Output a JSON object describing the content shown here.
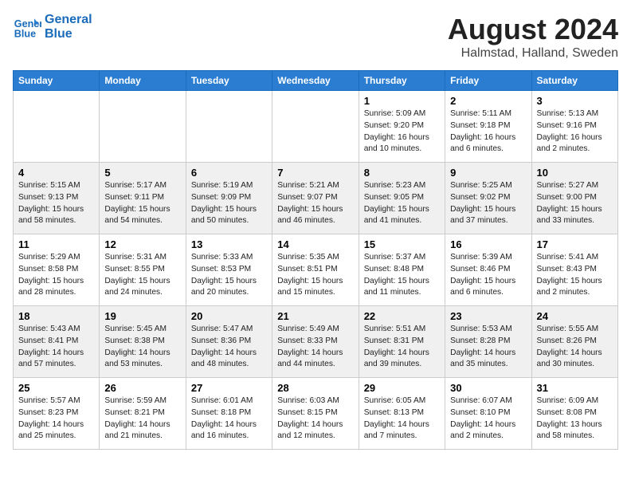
{
  "header": {
    "logo_line1": "General",
    "logo_line2": "Blue",
    "title": "August 2024",
    "subtitle": "Halmstad, Halland, Sweden"
  },
  "days_of_week": [
    "Sunday",
    "Monday",
    "Tuesday",
    "Wednesday",
    "Thursday",
    "Friday",
    "Saturday"
  ],
  "weeks": [
    [
      {
        "day": "",
        "info": ""
      },
      {
        "day": "",
        "info": ""
      },
      {
        "day": "",
        "info": ""
      },
      {
        "day": "",
        "info": ""
      },
      {
        "day": "1",
        "info": "Sunrise: 5:09 AM\nSunset: 9:20 PM\nDaylight: 16 hours\nand 10 minutes."
      },
      {
        "day": "2",
        "info": "Sunrise: 5:11 AM\nSunset: 9:18 PM\nDaylight: 16 hours\nand 6 minutes."
      },
      {
        "day": "3",
        "info": "Sunrise: 5:13 AM\nSunset: 9:16 PM\nDaylight: 16 hours\nand 2 minutes."
      }
    ],
    [
      {
        "day": "4",
        "info": "Sunrise: 5:15 AM\nSunset: 9:13 PM\nDaylight: 15 hours\nand 58 minutes."
      },
      {
        "day": "5",
        "info": "Sunrise: 5:17 AM\nSunset: 9:11 PM\nDaylight: 15 hours\nand 54 minutes."
      },
      {
        "day": "6",
        "info": "Sunrise: 5:19 AM\nSunset: 9:09 PM\nDaylight: 15 hours\nand 50 minutes."
      },
      {
        "day": "7",
        "info": "Sunrise: 5:21 AM\nSunset: 9:07 PM\nDaylight: 15 hours\nand 46 minutes."
      },
      {
        "day": "8",
        "info": "Sunrise: 5:23 AM\nSunset: 9:05 PM\nDaylight: 15 hours\nand 41 minutes."
      },
      {
        "day": "9",
        "info": "Sunrise: 5:25 AM\nSunset: 9:02 PM\nDaylight: 15 hours\nand 37 minutes."
      },
      {
        "day": "10",
        "info": "Sunrise: 5:27 AM\nSunset: 9:00 PM\nDaylight: 15 hours\nand 33 minutes."
      }
    ],
    [
      {
        "day": "11",
        "info": "Sunrise: 5:29 AM\nSunset: 8:58 PM\nDaylight: 15 hours\nand 28 minutes."
      },
      {
        "day": "12",
        "info": "Sunrise: 5:31 AM\nSunset: 8:55 PM\nDaylight: 15 hours\nand 24 minutes."
      },
      {
        "day": "13",
        "info": "Sunrise: 5:33 AM\nSunset: 8:53 PM\nDaylight: 15 hours\nand 20 minutes."
      },
      {
        "day": "14",
        "info": "Sunrise: 5:35 AM\nSunset: 8:51 PM\nDaylight: 15 hours\nand 15 minutes."
      },
      {
        "day": "15",
        "info": "Sunrise: 5:37 AM\nSunset: 8:48 PM\nDaylight: 15 hours\nand 11 minutes."
      },
      {
        "day": "16",
        "info": "Sunrise: 5:39 AM\nSunset: 8:46 PM\nDaylight: 15 hours\nand 6 minutes."
      },
      {
        "day": "17",
        "info": "Sunrise: 5:41 AM\nSunset: 8:43 PM\nDaylight: 15 hours\nand 2 minutes."
      }
    ],
    [
      {
        "day": "18",
        "info": "Sunrise: 5:43 AM\nSunset: 8:41 PM\nDaylight: 14 hours\nand 57 minutes."
      },
      {
        "day": "19",
        "info": "Sunrise: 5:45 AM\nSunset: 8:38 PM\nDaylight: 14 hours\nand 53 minutes."
      },
      {
        "day": "20",
        "info": "Sunrise: 5:47 AM\nSunset: 8:36 PM\nDaylight: 14 hours\nand 48 minutes."
      },
      {
        "day": "21",
        "info": "Sunrise: 5:49 AM\nSunset: 8:33 PM\nDaylight: 14 hours\nand 44 minutes."
      },
      {
        "day": "22",
        "info": "Sunrise: 5:51 AM\nSunset: 8:31 PM\nDaylight: 14 hours\nand 39 minutes."
      },
      {
        "day": "23",
        "info": "Sunrise: 5:53 AM\nSunset: 8:28 PM\nDaylight: 14 hours\nand 35 minutes."
      },
      {
        "day": "24",
        "info": "Sunrise: 5:55 AM\nSunset: 8:26 PM\nDaylight: 14 hours\nand 30 minutes."
      }
    ],
    [
      {
        "day": "25",
        "info": "Sunrise: 5:57 AM\nSunset: 8:23 PM\nDaylight: 14 hours\nand 25 minutes."
      },
      {
        "day": "26",
        "info": "Sunrise: 5:59 AM\nSunset: 8:21 PM\nDaylight: 14 hours\nand 21 minutes."
      },
      {
        "day": "27",
        "info": "Sunrise: 6:01 AM\nSunset: 8:18 PM\nDaylight: 14 hours\nand 16 minutes."
      },
      {
        "day": "28",
        "info": "Sunrise: 6:03 AM\nSunset: 8:15 PM\nDaylight: 14 hours\nand 12 minutes."
      },
      {
        "day": "29",
        "info": "Sunrise: 6:05 AM\nSunset: 8:13 PM\nDaylight: 14 hours\nand 7 minutes."
      },
      {
        "day": "30",
        "info": "Sunrise: 6:07 AM\nSunset: 8:10 PM\nDaylight: 14 hours\nand 2 minutes."
      },
      {
        "day": "31",
        "info": "Sunrise: 6:09 AM\nSunset: 8:08 PM\nDaylight: 13 hours\nand 58 minutes."
      }
    ]
  ]
}
